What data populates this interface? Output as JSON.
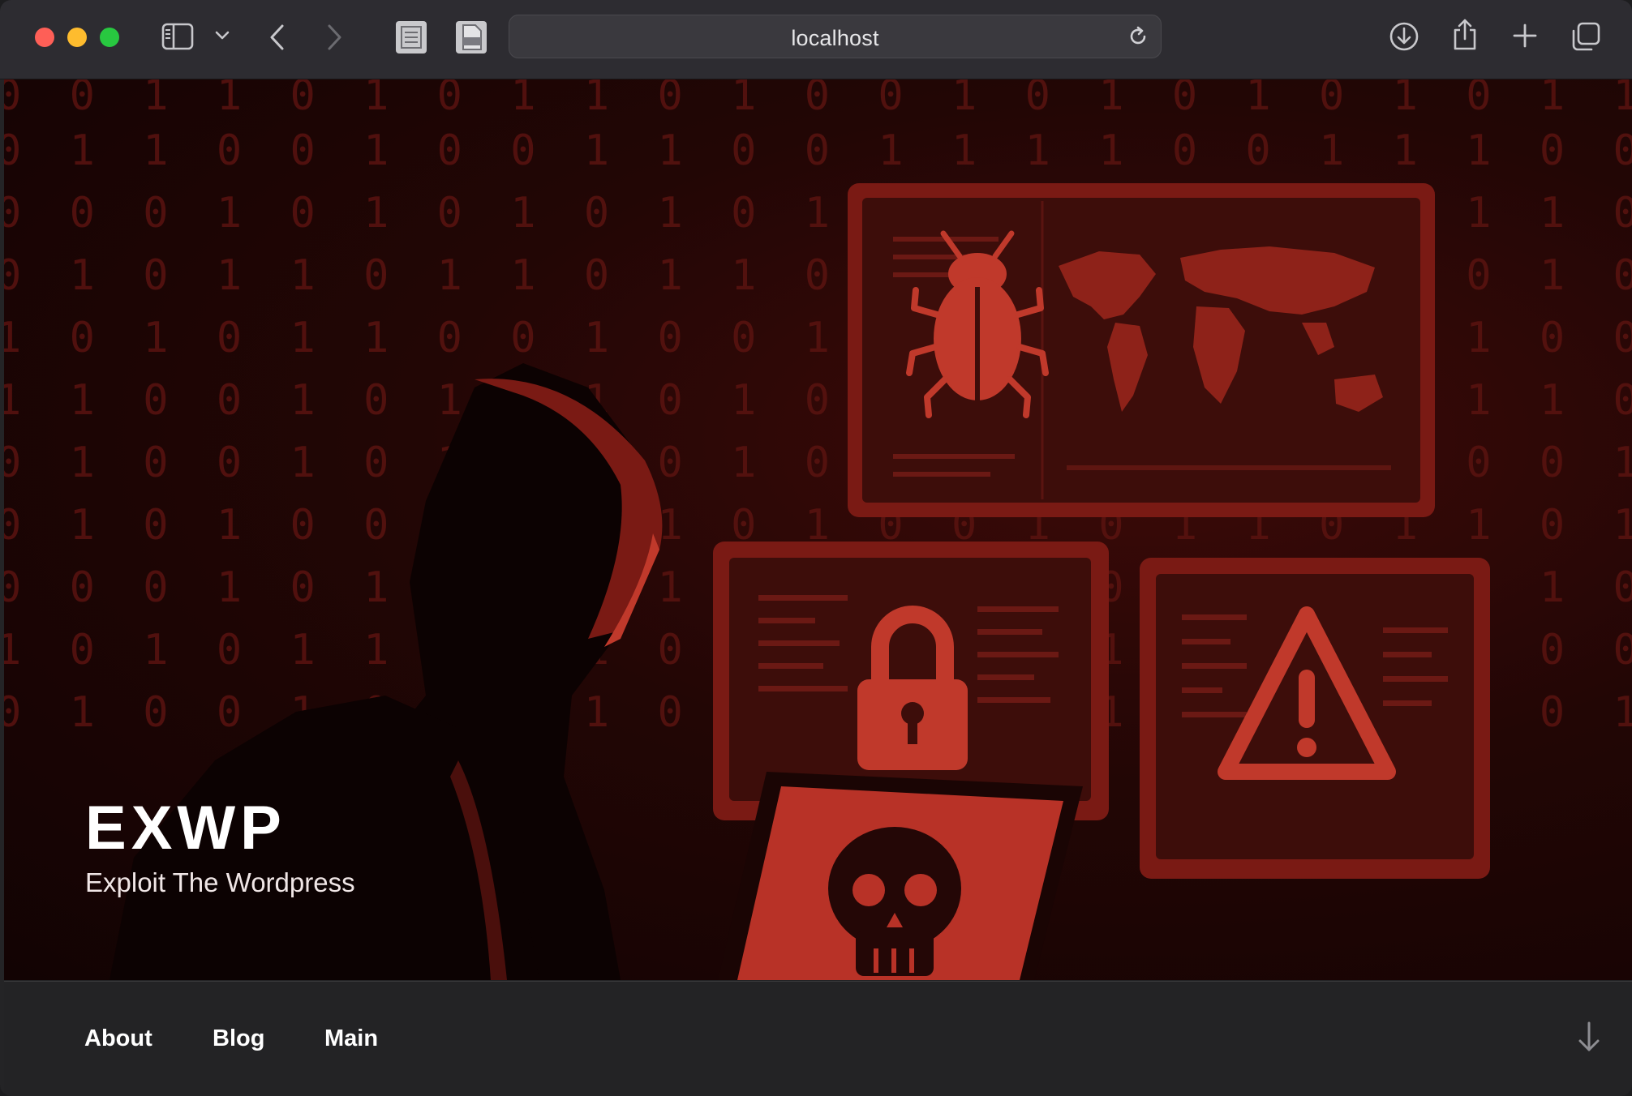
{
  "browser": {
    "address": "localhost",
    "icons": [
      "sidebar-icon",
      "chevron-down-icon",
      "back-icon",
      "forward-icon",
      "reader-icon",
      "document-icon",
      "reload-icon",
      "download-icon",
      "share-icon",
      "new-tab-icon",
      "tabs-overview-icon"
    ]
  },
  "hero": {
    "title": "EXWP",
    "tagline": "Exploit The Wordpress",
    "binary_rows": [
      "0 0 1 1 0 1 0 1 1 0 1 0 0 1 0 1 0 1 0 1 0 1 1 1 1 0 1 0 1 0 0 1 0 0 1 0 0 1 0",
      "0 1 1 0 0 1 0 0 1 1 0 0 1 1 1 1 0 0 1 1 1 0 0 1 1 1 1 0 1 1 1 0 1 1 1 1 0 1 1 0 1",
      "0 0 0 1 0 1 0 1 0 1 0 1 0 1 1 0 1 0 1 0 1 1 0 1 0 0 1 1 0 1 0 1 1 1 0 1 0 1 0",
      "0 1 0 1 1 0 1 1 0 1 1 0 1 1 0 1 1 0 0 1 0 1 0 1 0 0 0 1 1 0 1 0 1 1 1 0 1 1 0 1",
      "1 0 1 0 1 1 0 0 1 0 0 1 1 1 1 1 1 0 1 0 1 0 0 1 1 1 0 1 0 1 1 1 0 1 0 1 1 1 0",
      "1 1 0 0 1 0 1 0 1 0 1 0 0 1 1 0 0 1 0 1 1 1 0 1 0 0 1 0 1 0 1 1 0 0 1 0 1 0 1 0",
      "0 1 0 0 1 0 1 0 1 0 1 0 1 1 0 1 0 1 0 1 0 0 1 1 0 1 0 1 0 1 0 1 1 0 0 1 0 1 0 1",
      "0 1 0 1 0 0 1 0 1 1 0 1 0 0 1 0 1 1 0 1 1 0 1 0 1 0 1 0 1 0 0 1 0 1 1 0 1 0 1 1"
    ]
  },
  "nav": {
    "items": [
      {
        "label": "About"
      },
      {
        "label": "Blog"
      },
      {
        "label": "Main"
      }
    ]
  },
  "colors": {
    "accent": "#c0392b",
    "screen": "#b83227",
    "screen_dark": "#3a0c0a"
  }
}
